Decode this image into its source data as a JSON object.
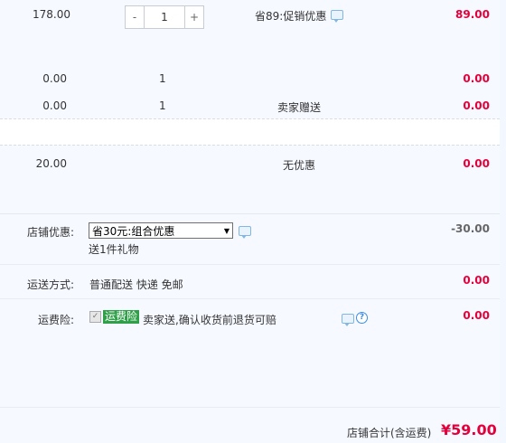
{
  "items": [
    {
      "price": "178.00",
      "qty": "1",
      "promo": "省89:促销优惠",
      "subtotal": "89.00",
      "stepper": {
        "minus": "-",
        "plus": "+"
      }
    },
    {
      "price": "0.00",
      "qty": "1",
      "promo": "",
      "subtotal": "0.00"
    },
    {
      "price": "0.00",
      "qty": "1",
      "promo": "卖家赠送",
      "subtotal": "0.00"
    },
    {
      "price": "20.00",
      "qty": "",
      "promo": "无优惠",
      "subtotal": "0.00"
    }
  ],
  "shop_discount": {
    "label": "店铺优惠:",
    "selected": "省30元:组合优惠",
    "gift": "送1件礼物",
    "amount": "-30.00"
  },
  "shipping": {
    "label": "运送方式:",
    "value": "普通配送 快递 免邮",
    "amount": "0.00"
  },
  "insurance": {
    "label": "运费险:",
    "tag": "运费险",
    "desc": "卖家送,确认收货前退货可赔",
    "amount": "0.00"
  },
  "total": {
    "label": "店铺合计(含运费)",
    "value": "¥59.00"
  },
  "icons": {
    "message": "message-icon",
    "help": "help-icon",
    "checkmark": "check-icon"
  },
  "colors": {
    "price_red": "#e4003a",
    "tag_green": "#2fa048",
    "link_blue": "#3a8ee6"
  }
}
